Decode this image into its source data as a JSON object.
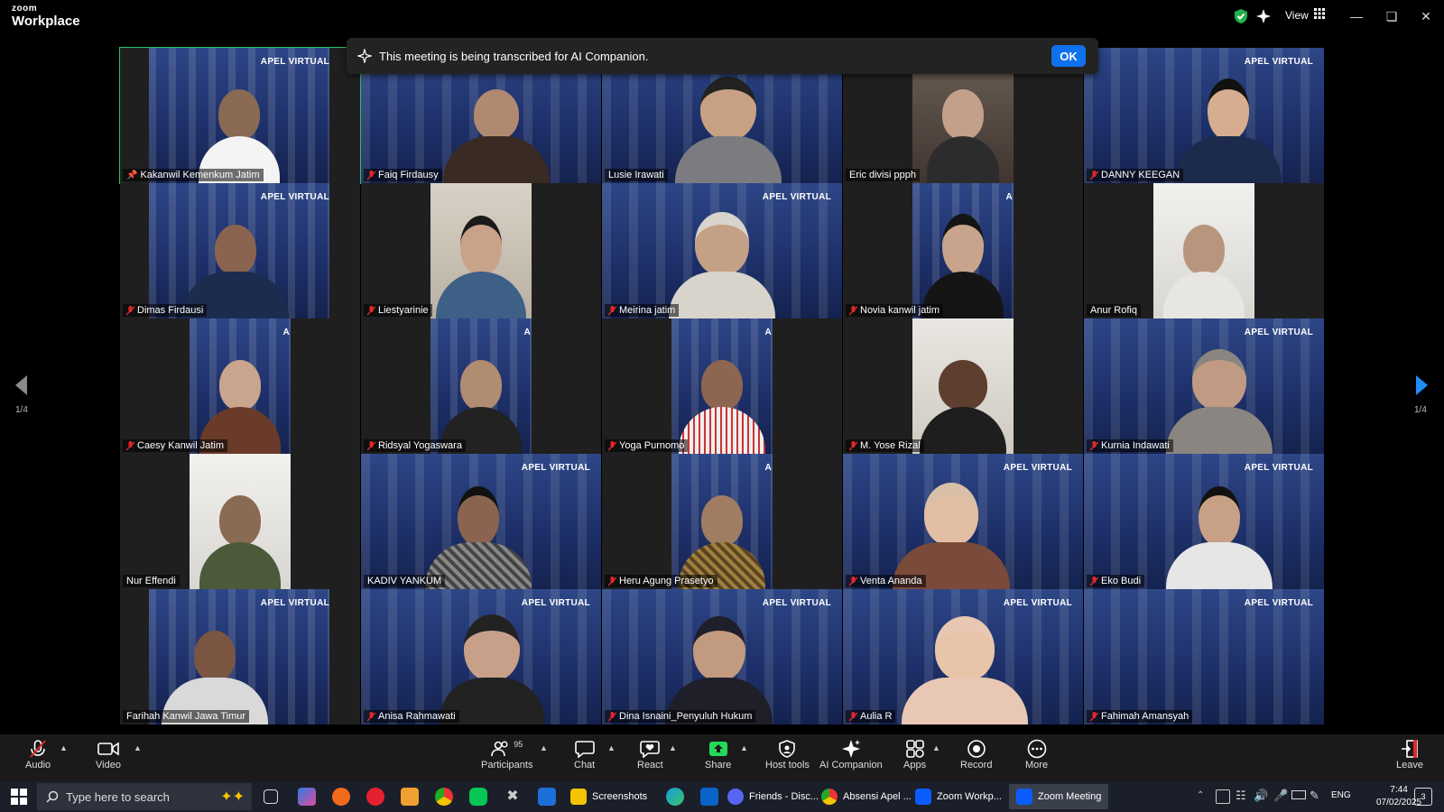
{
  "app": {
    "logo_line1": "zoom",
    "logo_line2": "Workplace"
  },
  "titlebar": {
    "view_label": "View"
  },
  "notification": {
    "text": "This meeting is being transcribed for AI Companion.",
    "ok_label": "OK"
  },
  "pagination": {
    "left": "1/4",
    "right": "1/4"
  },
  "watermark": "APEL VIRTUAL",
  "watermark_short": "A",
  "tiles": [
    {
      "name": "Kakanwil Kemenkum Jatim",
      "muted": false,
      "pinned": true
    },
    {
      "name": "Faiq Firdausy",
      "muted": true
    },
    {
      "name": "Lusie Irawati",
      "muted": false
    },
    {
      "name": "Eric divisi ppph",
      "muted": false
    },
    {
      "name": "DANNY KEEGAN",
      "muted": true
    },
    {
      "name": "Dimas Firdausi",
      "muted": true
    },
    {
      "name": "Liestyarinie",
      "muted": true
    },
    {
      "name": "Meirina jatim",
      "muted": true
    },
    {
      "name": "Novia kanwil jatim",
      "muted": true
    },
    {
      "name": "Anur Rofiq",
      "muted": false
    },
    {
      "name": "Caesy Kanwil Jatim",
      "muted": true
    },
    {
      "name": "Ridsyal Yogaswara",
      "muted": true
    },
    {
      "name": "Yoga Purnomo",
      "muted": true
    },
    {
      "name": "M. Yose Rizal",
      "muted": true
    },
    {
      "name": "Kurnia Indawati",
      "muted": true
    },
    {
      "name": "Nur Effendi",
      "muted": false
    },
    {
      "name": "KADIV YANKUM",
      "muted": false
    },
    {
      "name": "Heru Agung Prasetyo",
      "muted": true
    },
    {
      "name": "Venta Ananda",
      "muted": true
    },
    {
      "name": "Eko Budi",
      "muted": true
    },
    {
      "name": "Farihah Kanwil Jawa Timur",
      "muted": false
    },
    {
      "name": "Anisa Rahmawati",
      "muted": true
    },
    {
      "name": "Dina Isnaini_Penyuluh Hukum",
      "muted": true
    },
    {
      "name": "Aulia R",
      "muted": true
    },
    {
      "name": "Fahimah Amansyah",
      "muted": true
    }
  ],
  "toolbar": {
    "audio": "Audio",
    "video": "Video",
    "participants": "Participants",
    "participants_count": "95",
    "chat": "Chat",
    "react": "React",
    "share": "Share",
    "host_tools": "Host tools",
    "ai_companion": "AI Companion",
    "apps": "Apps",
    "record": "Record",
    "more": "More",
    "leave": "Leave"
  },
  "taskbar": {
    "search_placeholder": "Type here to search",
    "apps": [
      {
        "label": "Screenshots"
      },
      {
        "label": "Friends - Disc..."
      },
      {
        "label": "Absensi Apel ..."
      },
      {
        "label": "Zoom Workp..."
      },
      {
        "label": "Zoom Meeting"
      }
    ],
    "lang": "ENG",
    "time": "7:44",
    "date": "07/02/2025",
    "notification_count": "3"
  },
  "colors": {
    "accent": "#0e72ed",
    "active_speaker": "#27c26b",
    "mute_red": "#e02828",
    "share_green": "#23d959"
  }
}
